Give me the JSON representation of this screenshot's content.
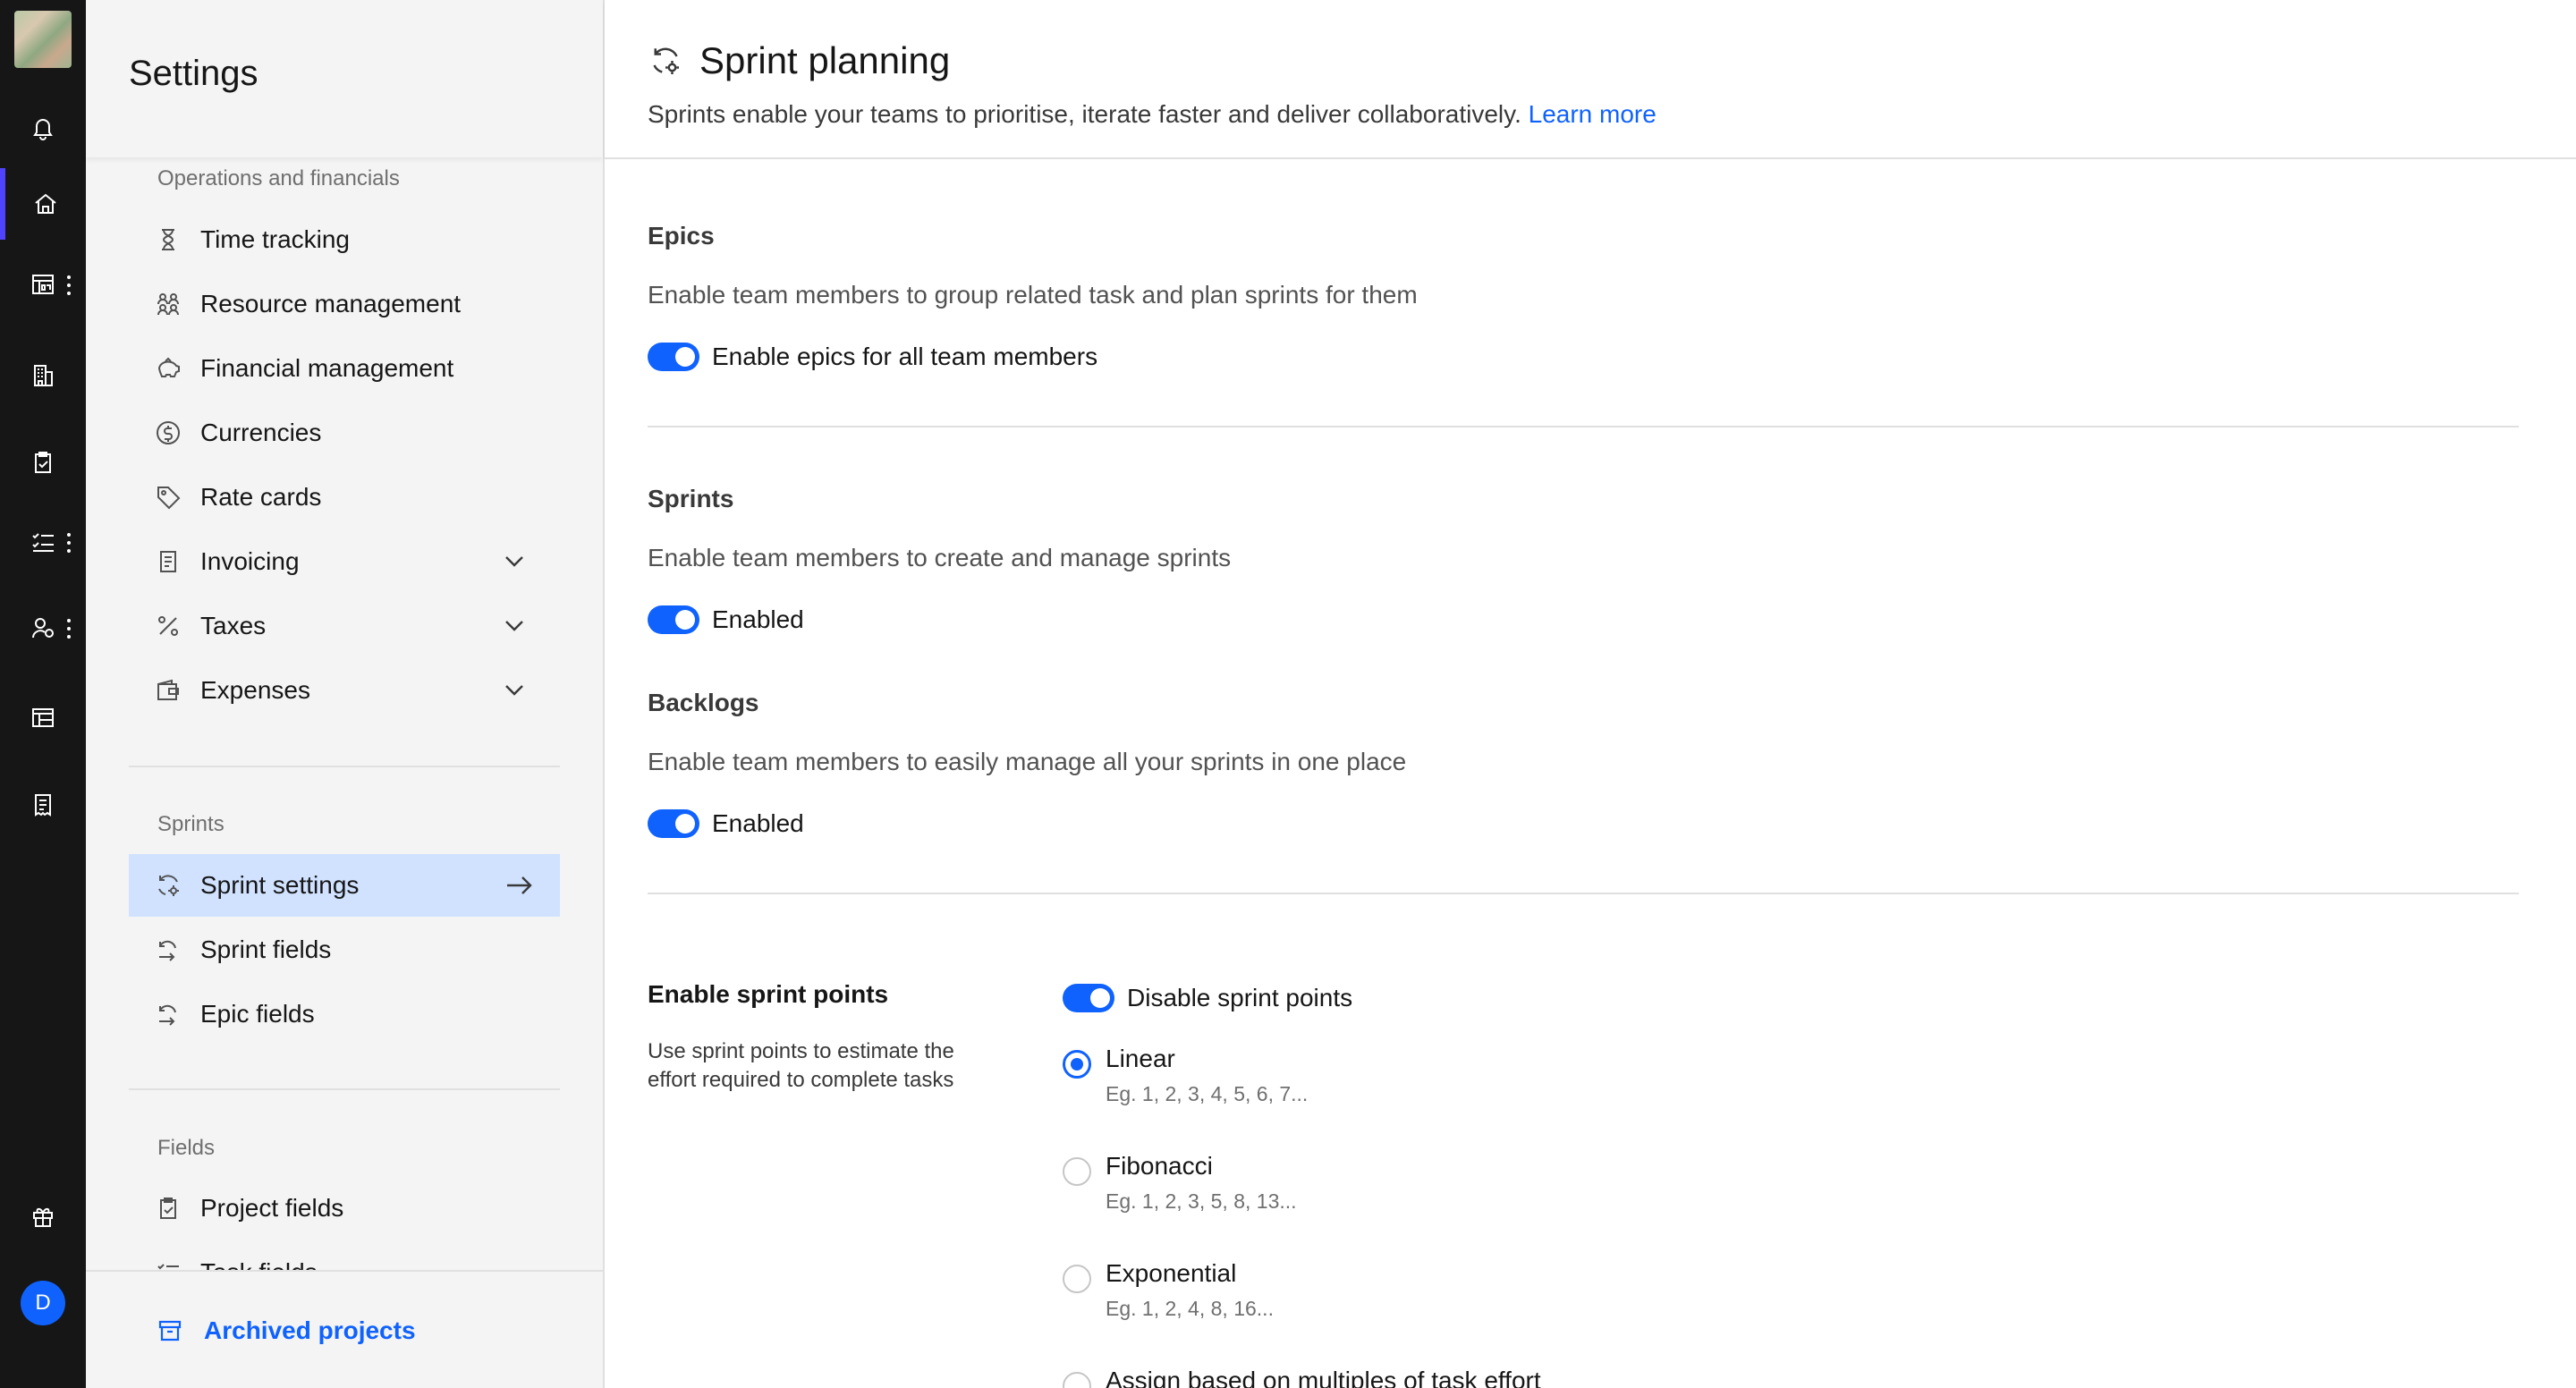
{
  "rail": {
    "avatar_initial": "D",
    "items": [
      "bell-icon",
      "home-icon",
      "dashboard-icon",
      "building-icon",
      "clipboard-icon",
      "checklist-icon",
      "people-settings-icon",
      "layout-icon",
      "receipt-icon",
      "gift-icon"
    ],
    "active_color": "#4f43ff"
  },
  "nav": {
    "title": "Settings",
    "sections": {
      "operations": {
        "label": "Operations and financials",
        "items": [
          {
            "label": "Time tracking",
            "icon": "hourglass-icon"
          },
          {
            "label": "Resource management",
            "icon": "resource-icon"
          },
          {
            "label": "Financial management",
            "icon": "piggy-bank-icon"
          },
          {
            "label": "Currencies",
            "icon": "dollar-icon"
          },
          {
            "label": "Rate cards",
            "icon": "tag-icon"
          },
          {
            "label": "Invoicing",
            "icon": "invoice-icon"
          },
          {
            "label": "Taxes",
            "icon": "percent-icon"
          },
          {
            "label": "Expenses",
            "icon": "wallet-icon"
          }
        ]
      },
      "sprints": {
        "label": "Sprints",
        "items": [
          {
            "label": "Sprint settings",
            "icon": "sprint-icon"
          },
          {
            "label": "Sprint fields",
            "icon": "sprint-field-icon"
          },
          {
            "label": "Epic fields",
            "icon": "epic-field-icon"
          }
        ]
      },
      "fields": {
        "label": "Fields",
        "items": [
          {
            "label": "Project fields",
            "icon": "clipboard-check-icon"
          },
          {
            "label": "Task fields",
            "icon": "checklist-icon"
          }
        ]
      }
    },
    "archived_label": "Archived projects"
  },
  "main": {
    "title": "Sprint planning",
    "subtitle": "Sprints enable your teams to prioritise, iterate faster and deliver collaboratively.",
    "learn_more": "Learn more",
    "epics": {
      "heading": "Epics",
      "description": "Enable team members to group related task and plan sprints for them",
      "toggle_label": "Enable epics for all team members",
      "enabled": true
    },
    "sprints": {
      "heading": "Sprints",
      "description": "Enable team members to create and manage sprints",
      "toggle_label": "Enabled",
      "enabled": true
    },
    "backlogs": {
      "heading": "Backlogs",
      "description": "Enable team members to easily manage all your sprints in one place",
      "toggle_label": "Enabled",
      "enabled": true
    },
    "sprint_points": {
      "heading": "Enable sprint points",
      "description": "Use sprint points to estimate the effort required to complete tasks",
      "toggle_label": "Disable sprint points",
      "enabled": true,
      "options": [
        {
          "label": "Linear",
          "example": "Eg. 1, 2, 3, 4, 5, 6, 7...",
          "selected": true
        },
        {
          "label": "Fibonacci",
          "example": "Eg. 1, 2, 3, 5, 8, 13...",
          "selected": false
        },
        {
          "label": "Exponential",
          "example": "Eg. 1, 2, 4, 8, 16...",
          "selected": false
        },
        {
          "label": "Assign based on multiples of task effort",
          "example": "",
          "selected": false
        }
      ]
    }
  },
  "colors": {
    "accent": "#0f62fe",
    "selected_bg": "#d0e2ff",
    "rail_bg": "#161616"
  }
}
